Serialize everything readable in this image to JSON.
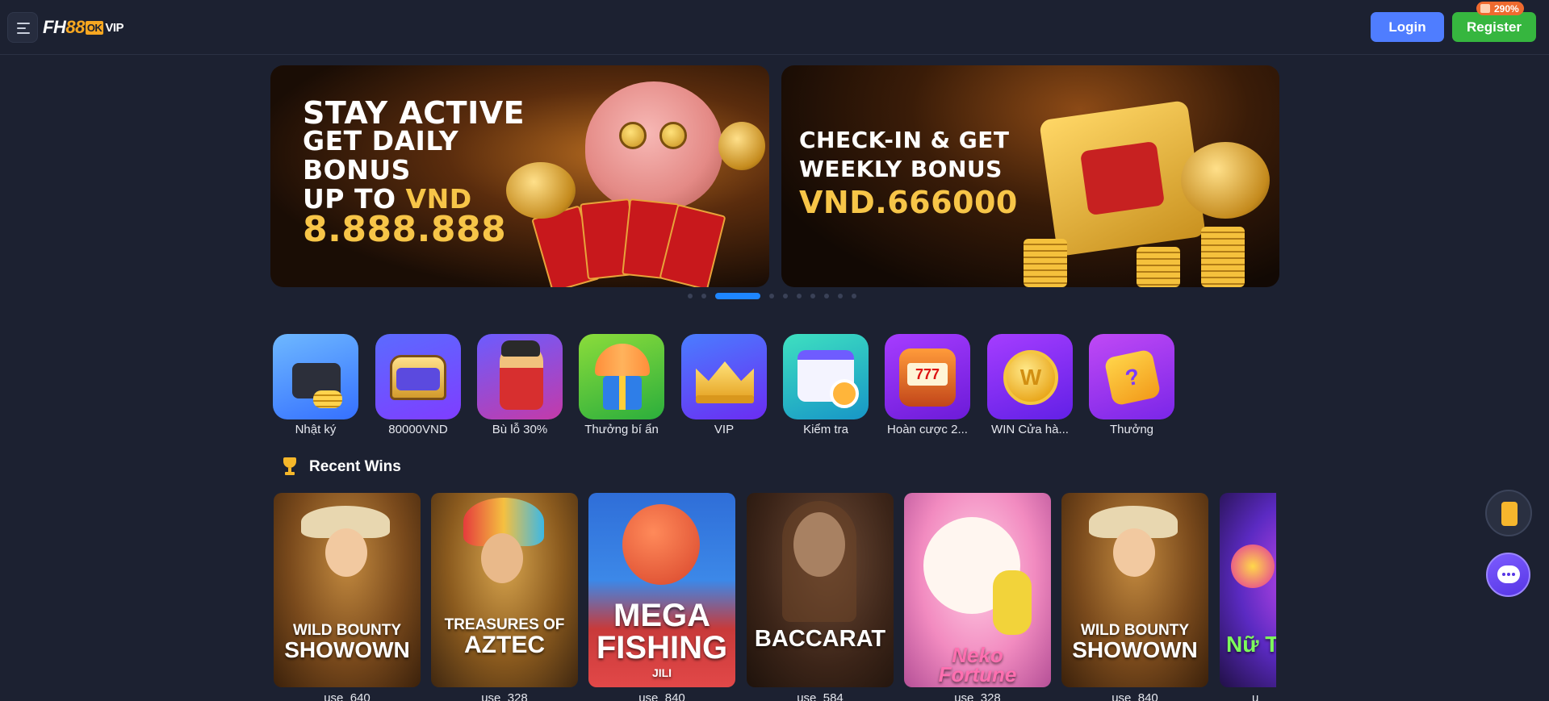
{
  "header": {
    "logo": {
      "fh": "FH",
      "n88": "88",
      "ok": "OK",
      "vip": "VIP"
    },
    "login_label": "Login",
    "register_label": "Register",
    "register_badge": "290%"
  },
  "banners": [
    {
      "lines": [
        "STAY ACTIVE",
        "GET DAILY",
        "BONUS",
        "UP TO",
        "VND",
        "8.888.888"
      ]
    },
    {
      "lines": [
        "CHECK-IN & GET",
        "WEEKLY BONUS",
        "VND.666000"
      ]
    }
  ],
  "carousel": {
    "total": 10,
    "active": 2
  },
  "categories": [
    {
      "label": "Nhật ký",
      "icon": "wallet-icon"
    },
    {
      "label": "80000VND",
      "icon": "treasure-chest-icon"
    },
    {
      "label": "Bù lỗ 30%",
      "icon": "fortune-god-icon"
    },
    {
      "label": "Thưởng bí ẩn",
      "icon": "gift-parachute-icon"
    },
    {
      "label": "VIP",
      "icon": "crown-icon"
    },
    {
      "label": "Kiểm tra",
      "icon": "calendar-icon"
    },
    {
      "label": "Hoàn cược 2...",
      "icon": "slot-machine-icon"
    },
    {
      "label": "WIN Cửa hà...",
      "icon": "coin-icon"
    },
    {
      "label": "Thưởng",
      "icon": "mystery-box-icon"
    }
  ],
  "recent_wins": {
    "title": "Recent Wins",
    "games": [
      {
        "title_top": "WILD BOUNTY",
        "title_main": "SHOWOWN",
        "user": "use_640"
      },
      {
        "title_top": "TREASURES OF",
        "title_main": "AZTEC",
        "user": "use_328"
      },
      {
        "title_top": "MEGA",
        "title_main": "FISHING",
        "sub": "JILI",
        "user": "use_840"
      },
      {
        "title_top": "",
        "title_main": "BACCARAT",
        "user": "use_584"
      },
      {
        "title_top": "Neko",
        "title_main": "Fortune",
        "user": "use_328"
      },
      {
        "title_top": "WILD BOUNTY",
        "title_main": "SHOWOWN",
        "user": "use_840"
      },
      {
        "title_top": "",
        "title_main": "Nữ Th",
        "user": "u"
      }
    ]
  },
  "colors": {
    "background": "#1c2131",
    "login": "#4f7dff",
    "register": "#36b63f",
    "badge": "#ef6a2f",
    "active_dot": "#1e86ff",
    "gold_text": "#f7c548"
  }
}
